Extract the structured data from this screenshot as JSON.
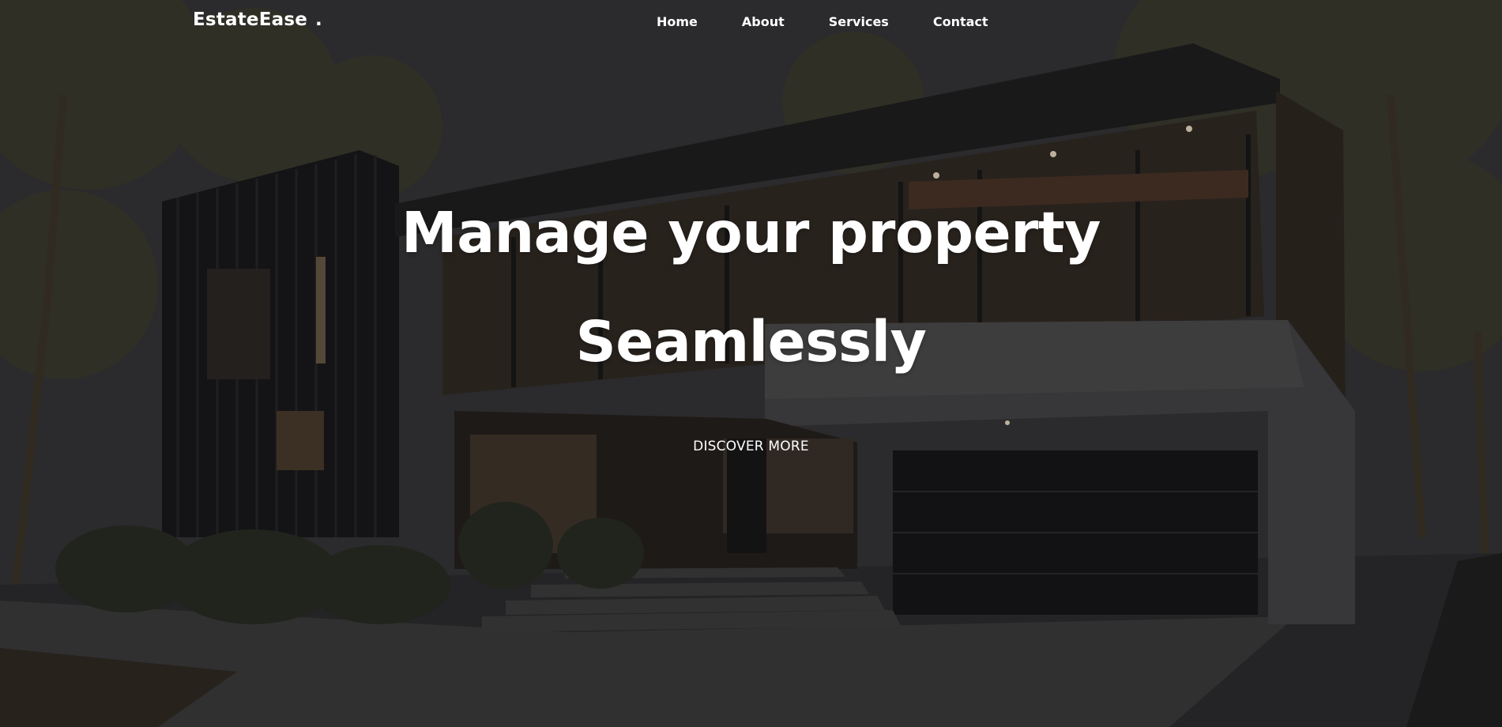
{
  "brand": {
    "name": "EstateEase",
    "dot": "."
  },
  "nav": {
    "items": [
      "Home",
      "About",
      "Services",
      "Contact"
    ]
  },
  "hero": {
    "line1": "Manage your property",
    "line2": "Seamlessly",
    "cta_label": "DISCOVER MORE",
    "background_image": "modern two-story house at dusk with dark vertical cladding, large glass windows, garage door and trees"
  },
  "colors": {
    "text": "#ffffff",
    "overlay": "#1e1d1f"
  }
}
